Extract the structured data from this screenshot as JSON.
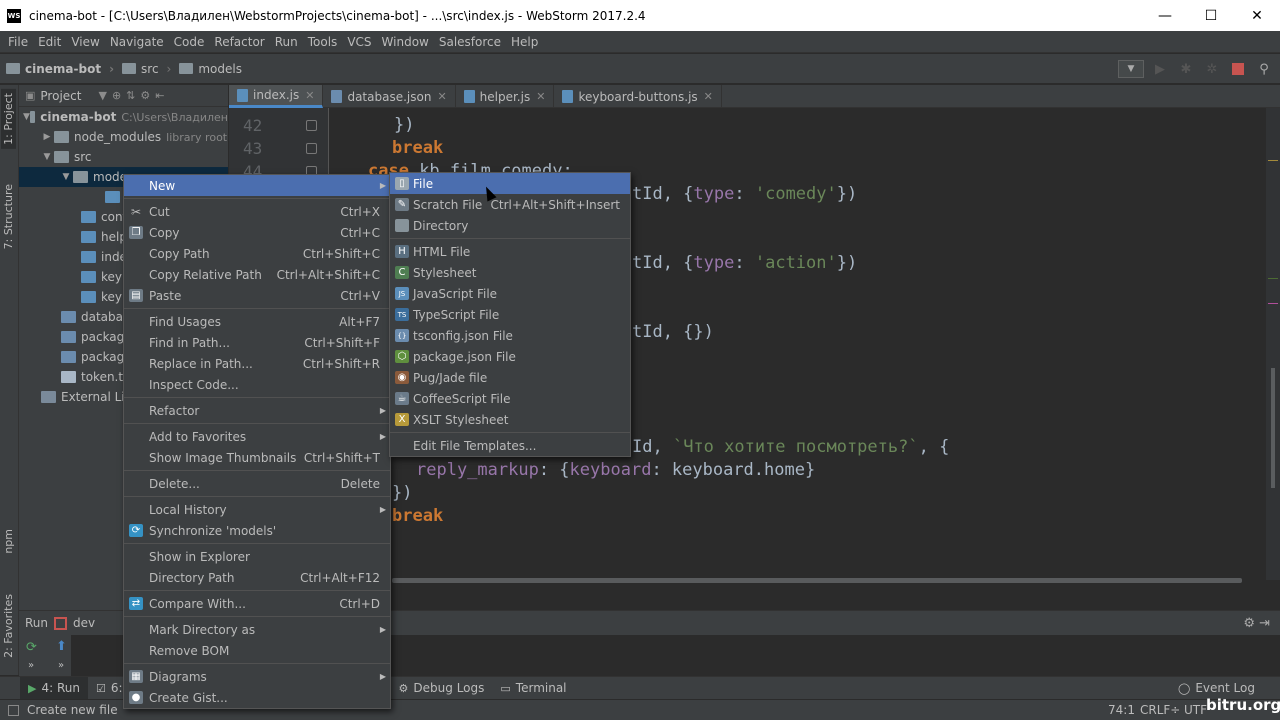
{
  "window": {
    "title": "cinema-bot - [C:\\Users\\Владилен\\WebstormProjects\\cinema-bot] - ...\\src\\index.js - WebStorm 2017.2.4",
    "app_icon_text": "WS",
    "minimize": "—",
    "maximize": "☐",
    "close": "✕"
  },
  "menubar": [
    "File",
    "Edit",
    "View",
    "Navigate",
    "Code",
    "Refactor",
    "Run",
    "Tools",
    "VCS",
    "Window",
    "Salesforce",
    "Help"
  ],
  "breadcrumb": [
    "cinema-bot",
    "src",
    "models"
  ],
  "left_strip": {
    "project": "1: Project",
    "structure": "7: Structure",
    "npm": "npm",
    "favorites": "2: Favorites"
  },
  "project_panel": {
    "title": "Project",
    "tree": {
      "root": "cinema-bot",
      "root_path": "C:\\Users\\Владилен",
      "node_modules": "node_modules",
      "node_modules_tag": "library root",
      "src": "src",
      "models": "mode",
      "child1": "",
      "config": "conf",
      "helper": "help",
      "index": "inde",
      "keyboard1": "keyb",
      "keyboard2": "keyb",
      "database": "database",
      "package1": "package",
      "package2": "package",
      "token": "token.txt",
      "external": "External Libr"
    }
  },
  "tabs": [
    {
      "label": "index.js",
      "active": true
    },
    {
      "label": "database.json"
    },
    {
      "label": "helper.js"
    },
    {
      "label": "keyboard-buttons.js"
    }
  ],
  "gutter": {
    "lines": [
      "42",
      "43",
      "44"
    ]
  },
  "code": {
    "l1": "})",
    "break1": "break",
    "case_kw": "case",
    "case_rest": " kb.film.comedy:",
    "comedy_pre": "tId, {",
    "type1": "type",
    "comedy_str": "'comedy'",
    "comedy_end": "})",
    "action_pre": "tId, {",
    "type2": "type",
    "action_str": "'action'",
    "action_end": "})",
    "empty_line": "tId, {})",
    "msg_pre": "Id, ",
    "msg_str": "`Что хотите посмотреть?`",
    "msg_end": ", {",
    "reply_prop": "reply_markup",
    "reply_mid": ": {",
    "keyboard_prop": "keyboard",
    "reply_end": ": keyboard.home}",
    "close": "})",
    "break2": "break"
  },
  "context_menu": [
    {
      "label": "New",
      "submenu": true,
      "selected": true,
      "icon": "none"
    },
    {
      "sep": true
    },
    {
      "label": "Cut",
      "shortcut": "Ctrl+X",
      "icon": "scissors-icon"
    },
    {
      "label": "Copy",
      "shortcut": "Ctrl+C",
      "icon": "copy-icon"
    },
    {
      "label": "Copy Path",
      "shortcut": "Ctrl+Shift+C"
    },
    {
      "label": "Copy Relative Path",
      "shortcut": "Ctrl+Alt+Shift+C"
    },
    {
      "label": "Paste",
      "shortcut": "Ctrl+V",
      "icon": "paste-icon"
    },
    {
      "sep": true
    },
    {
      "label": "Find Usages",
      "shortcut": "Alt+F7"
    },
    {
      "label": "Find in Path...",
      "shortcut": "Ctrl+Shift+F"
    },
    {
      "label": "Replace in Path...",
      "shortcut": "Ctrl+Shift+R"
    },
    {
      "label": "Inspect Code..."
    },
    {
      "sep": true
    },
    {
      "label": "Refactor",
      "submenu": true
    },
    {
      "sep": true
    },
    {
      "label": "Add to Favorites",
      "submenu": true
    },
    {
      "label": "Show Image Thumbnails",
      "shortcut": "Ctrl+Shift+T"
    },
    {
      "sep": true
    },
    {
      "label": "Delete...",
      "shortcut": "Delete"
    },
    {
      "sep": true
    },
    {
      "label": "Local History",
      "submenu": true
    },
    {
      "label": "Synchronize 'models'",
      "icon": "sync-icon"
    },
    {
      "sep": true
    },
    {
      "label": "Show in Explorer"
    },
    {
      "label": "Directory Path",
      "shortcut": "Ctrl+Alt+F12"
    },
    {
      "sep": true
    },
    {
      "label": "Compare With...",
      "shortcut": "Ctrl+D",
      "icon": "compare-icon"
    },
    {
      "sep": true
    },
    {
      "label": "Mark Directory as",
      "submenu": true
    },
    {
      "label": "Remove BOM"
    },
    {
      "sep": true
    },
    {
      "label": "Diagrams",
      "submenu": true,
      "icon": "diagram-icon"
    },
    {
      "label": "Create Gist...",
      "icon": "github-icon"
    }
  ],
  "new_submenu": [
    {
      "label": "File",
      "selected": true,
      "icon": "file-icon"
    },
    {
      "label": "Scratch File",
      "shortcut": "Ctrl+Alt+Shift+Insert",
      "icon": "scratch-icon"
    },
    {
      "label": "Directory",
      "icon": "folder-icon"
    },
    {
      "sep": true
    },
    {
      "label": "HTML File",
      "icon": "html-icon"
    },
    {
      "label": "Stylesheet",
      "icon": "css-icon"
    },
    {
      "label": "JavaScript File",
      "icon": "js-icon"
    },
    {
      "label": "TypeScript File",
      "icon": "ts-icon"
    },
    {
      "label": "tsconfig.json File",
      "icon": "json-icon"
    },
    {
      "label": "package.json File",
      "icon": "node-icon"
    },
    {
      "label": "Pug/Jade file",
      "icon": "pug-icon"
    },
    {
      "label": "CoffeeScript File",
      "icon": "coffee-icon"
    },
    {
      "label": "XSLT Stylesheet",
      "icon": "xslt-icon"
    },
    {
      "sep": true
    },
    {
      "label": "Edit File Templates..."
    }
  ],
  "run_panel": {
    "label": "Run",
    "config": "dev"
  },
  "bottom_tabs": [
    {
      "label": "4: Run",
      "active": true
    },
    {
      "label": "6:"
    },
    {
      "label": "Debug Logs"
    },
    {
      "label": "Terminal"
    },
    {
      "label": "Event Log"
    }
  ],
  "status": {
    "message": "Create new file",
    "position": "74:1",
    "line_sep": "CRLF÷",
    "encoding": "UTF"
  },
  "watermark": "bitru.org",
  "colors": {
    "selection": "#4b6eaf",
    "keyword": "#cc7832",
    "string": "#6a8759",
    "property": "#9876aa"
  }
}
